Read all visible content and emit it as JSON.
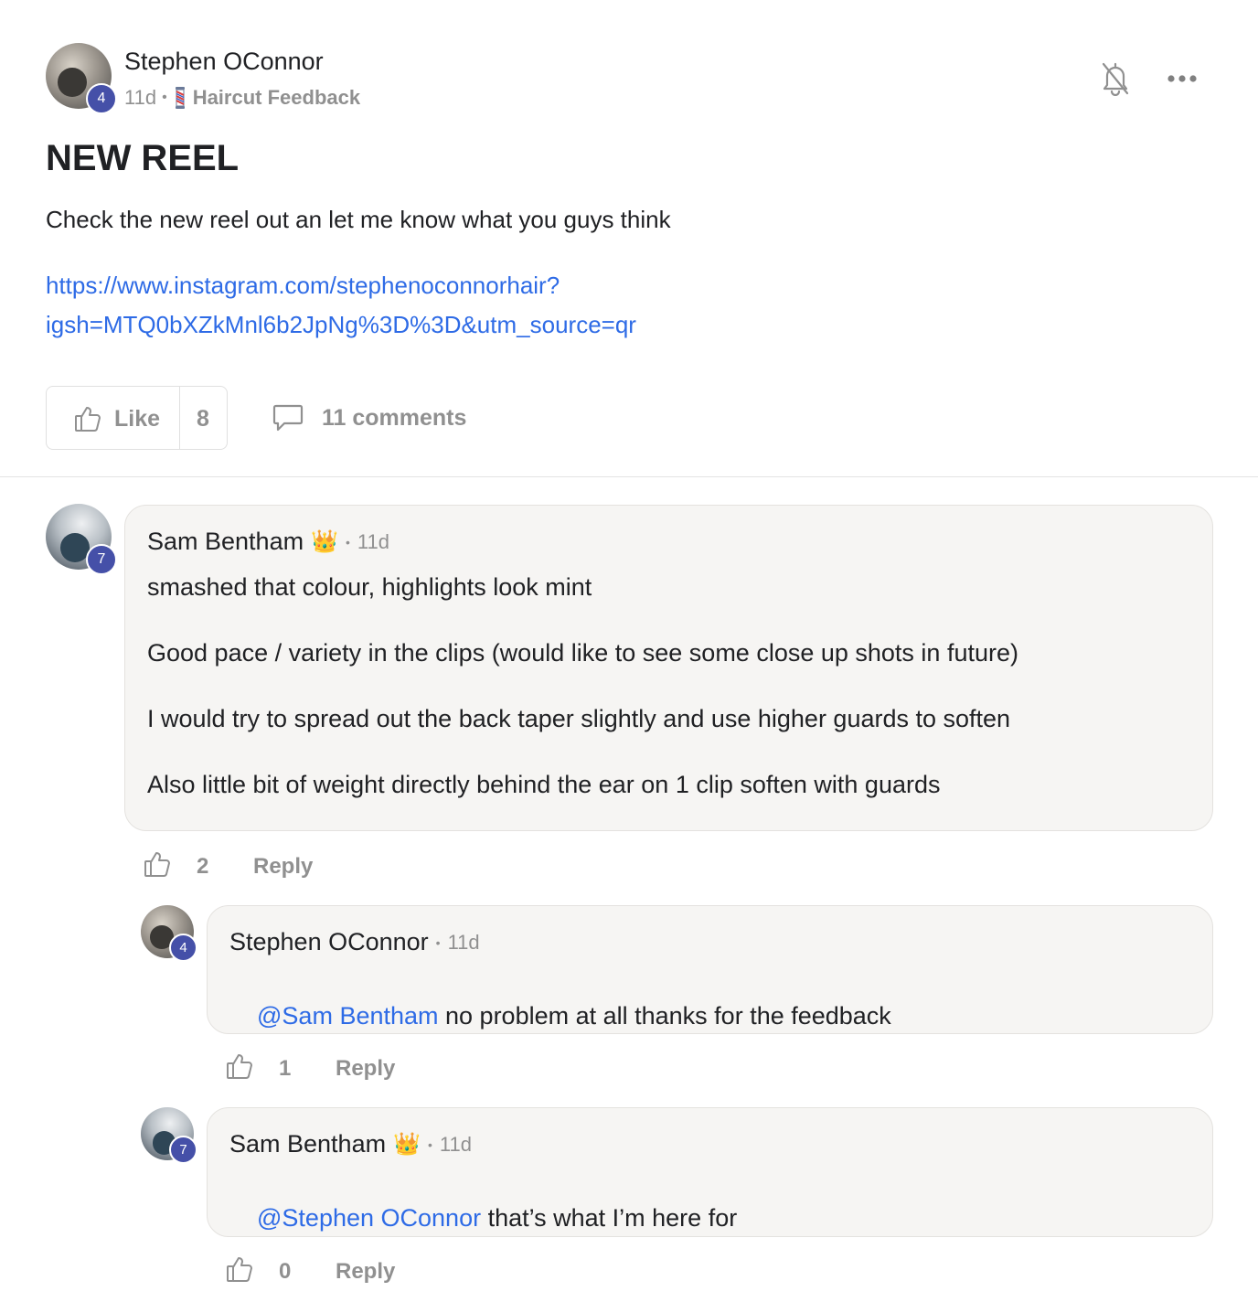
{
  "post": {
    "author": "Stephen OConnor",
    "author_level": "4",
    "age": "11d",
    "separator": "•",
    "category_icon": "barber-pole-icon",
    "category": "Haircut Feedback",
    "title": "NEW REEL",
    "body": "Check the new reel out an let me know what you guys think",
    "link_line1": "https://www.instagram.com/stephenoconnorhair?",
    "link_line2": "igsh=MTQ0bXZkMnl6b2JpNg%3D%3D&utm_source=qr",
    "like_label": "Like",
    "like_count": "8",
    "comments_label": "11 comments"
  },
  "colors": {
    "accent_link": "#2e6be6",
    "level_badge": "#4550a8",
    "muted": "#909090",
    "bubble_bg": "#f6f5f3"
  },
  "comments": [
    {
      "author": "Sam Bentham",
      "badge": "👑",
      "level": "7",
      "time": "11d",
      "paragraphs": [
        "smashed that colour, highlights look mint",
        "Good pace / variety in the clips (would like to see some close up shots in future)",
        "I would try to spread out the back taper slightly and use higher guards to soften",
        "Also little bit of weight directly behind the ear on 1 clip soften with guards"
      ],
      "likes": "2",
      "reply_label": "Reply"
    },
    {
      "author": "Stephen OConnor",
      "level": "4",
      "time": "11d",
      "mention": "@Sam Bentham",
      "text": " no problem at all thanks for the feedback",
      "likes": "1",
      "reply_label": "Reply"
    },
    {
      "author": "Sam Bentham",
      "badge": "👑",
      "level": "7",
      "time": "11d",
      "mention": "@Stephen OConnor",
      "text": " that’s what I’m here for",
      "likes": "0",
      "reply_label": "Reply"
    }
  ],
  "icons": {
    "notification": "bell-off-icon",
    "more": "more-horizontal-icon",
    "like": "thumbs-up-icon",
    "comment": "comment-icon"
  }
}
